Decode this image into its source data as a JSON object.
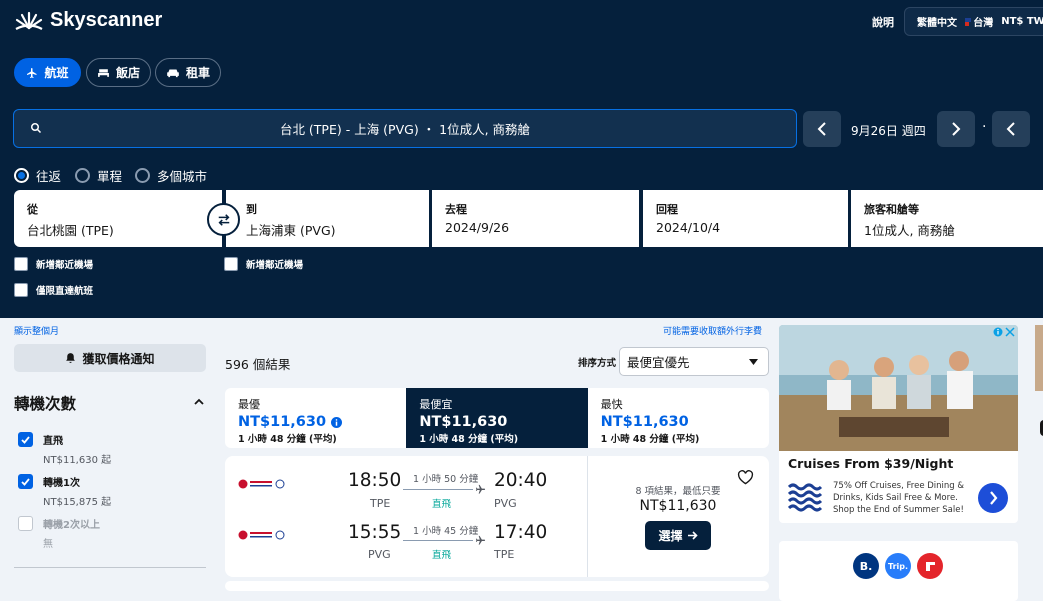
{
  "header": {
    "brand": "Skyscanner",
    "help": "說明",
    "language": "繁體中文",
    "region": "台灣",
    "currency": "NT$ TWD"
  },
  "nav": {
    "flights": "航班",
    "hotels": "飯店",
    "cars": "租車"
  },
  "search": {
    "summary": "台北 (TPE) - 上海 (PVG) ・ 1位成人, 商務艙",
    "date": "9月26日 週四"
  },
  "trip": {
    "round": "往返",
    "oneway": "單程",
    "multi": "多個城市"
  },
  "form": {
    "from_label": "從",
    "from_value": "台北桃園 (TPE)",
    "to_label": "到",
    "to_value": "上海浦東 (PVG)",
    "depart_label": "去程",
    "depart_value": "2024/9/26",
    "return_label": "回程",
    "return_value": "2024/10/4",
    "pax_label": "旅客和艙等",
    "pax_value": "1位成人, 商務艙",
    "nearby_from": "新增鄰近機場",
    "nearby_to": "新增鄰近機場",
    "direct_only": "僅限直達航班"
  },
  "filters": {
    "whole_month": "顯示整個月",
    "price_alert": "獲取價格通知",
    "stops_title": "轉機次數",
    "stops": [
      {
        "label": "直飛",
        "price": "NT$11,630 起"
      },
      {
        "label": "轉機1次",
        "price": "NT$15,875 起"
      },
      {
        "label": "轉機2次以上",
        "price": "無"
      }
    ]
  },
  "results": {
    "fees_note": "可能需要收取額外行李費",
    "count": "596 個結果",
    "sort_label": "排序方式",
    "sort_value": "最便宜優先",
    "tabs": [
      {
        "label": "最優",
        "price": "NT$11,630",
        "duration": "1 小時 48 分鐘 (平均)"
      },
      {
        "label": "最便宜",
        "price": "NT$11,630",
        "duration": "1 小時 48 分鐘 (平均)"
      },
      {
        "label": "最快",
        "price": "NT$11,630",
        "duration": "1 小時 48 分鐘 (平均)"
      }
    ],
    "card": {
      "out": {
        "dep": "18:50",
        "dep_ap": "TPE",
        "dur": "1 小時 50 分鐘",
        "stop": "直飛",
        "arr": "20:40",
        "arr_ap": "PVG"
      },
      "back": {
        "dep": "15:55",
        "dep_ap": "PVG",
        "dur": "1 小時 45 分鐘",
        "stop": "直飛",
        "arr": "17:40",
        "arr_ap": "TPE"
      },
      "deals": "8 項結果，最低只要",
      "price": "NT$11,630",
      "select": "選擇"
    }
  },
  "ad": {
    "title": "Cruises From $39/Night",
    "body": "75% Off Cruises, Free Dining & Drinks, Kids Sail Free & More. Shop the End of Summer Sale!",
    "logo_b": "B.",
    "logo_trip": "Trip."
  },
  "colors": {
    "navy": "#05203c",
    "blue": "#0062e3",
    "teal": "#00a698"
  }
}
